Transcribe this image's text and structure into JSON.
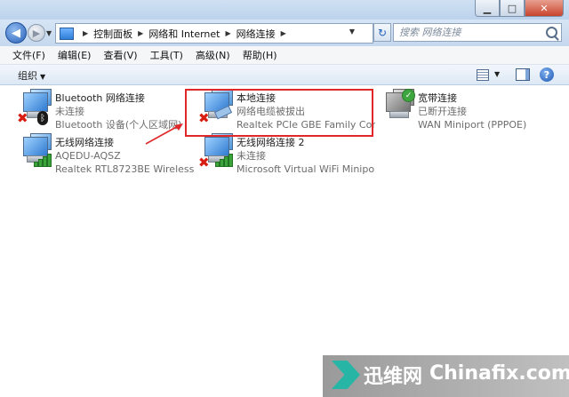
{
  "window": {
    "controls": {
      "minimize": "▁",
      "maximize": "□",
      "close": "✕"
    }
  },
  "nav": {
    "breadcrumb": [
      "控制面板",
      "网络和 Internet",
      "网络连接"
    ],
    "search_placeholder": "搜索 网络连接"
  },
  "menu": {
    "items": [
      "文件(F)",
      "编辑(E)",
      "查看(V)",
      "工具(T)",
      "高级(N)",
      "帮助(H)"
    ]
  },
  "command_bar": {
    "organize_label": "组织"
  },
  "connections": [
    {
      "name": "Bluetooth 网络连接",
      "status": "未连接",
      "device": "Bluetooth 设备(个人区域网)"
    },
    {
      "name": "本地连接",
      "status": "网络电缆被拔出",
      "device": "Realtek PCIe GBE Family Contr..."
    },
    {
      "name": "宽带连接",
      "status": "已断开连接",
      "device": "WAN Miniport (PPPOE)"
    },
    {
      "name": "无线网络连接",
      "status": "AQEDU-AQSZ",
      "device": "Realtek RTL8723BE Wireless L..."
    },
    {
      "name": "无线网络连接 2",
      "status": "未连接",
      "device": "Microsoft Virtual WiFi Minipor..."
    }
  ],
  "watermark": {
    "cn": "迅维网",
    "en": "Chinafix.com"
  },
  "colors": {
    "highlight": "#e0282a",
    "link_status": "#6d6d6d"
  }
}
